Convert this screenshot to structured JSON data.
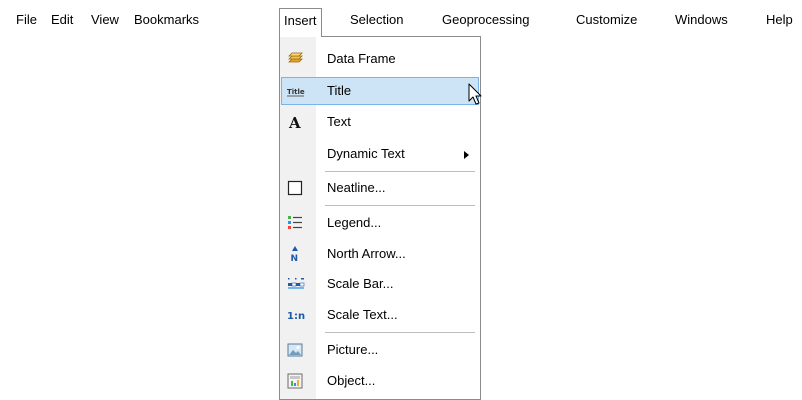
{
  "menubar": {
    "items": [
      {
        "label": "File"
      },
      {
        "label": "Edit"
      },
      {
        "label": "View"
      },
      {
        "label": "Bookmarks"
      },
      {
        "label": "Insert"
      },
      {
        "label": "Selection"
      },
      {
        "label": "Geoprocessing"
      },
      {
        "label": "Customize"
      },
      {
        "label": "Windows"
      },
      {
        "label": "Help"
      }
    ],
    "open_item": "Insert"
  },
  "insert_menu": {
    "items": [
      {
        "label": "Data Frame",
        "icon": "data-frame-icon"
      },
      {
        "label": "Title",
        "icon": "title-icon",
        "highlighted": true
      },
      {
        "label": "Text",
        "icon": "text-icon"
      },
      {
        "label": "Dynamic Text",
        "icon": "",
        "has_submenu": true
      },
      {
        "label": "Neatline...",
        "icon": "neatline-icon"
      },
      {
        "label": "Legend...",
        "icon": "legend-icon"
      },
      {
        "label": "North Arrow...",
        "icon": "north-arrow-icon"
      },
      {
        "label": "Scale Bar...",
        "icon": "scale-bar-icon"
      },
      {
        "label": "Scale Text...",
        "icon": "scale-text-icon"
      },
      {
        "label": "Picture...",
        "icon": "picture-icon"
      },
      {
        "label": "Object...",
        "icon": "object-icon"
      }
    ],
    "icon_text": {
      "title": "Title",
      "text": "A",
      "north": "N",
      "scale_text": "1:n"
    }
  },
  "colors": {
    "highlight_bg": "#cde4f7",
    "highlight_border": "#7ab3e6",
    "gutter": "#f1f1f1",
    "menu_border": "#8b8b8b"
  }
}
